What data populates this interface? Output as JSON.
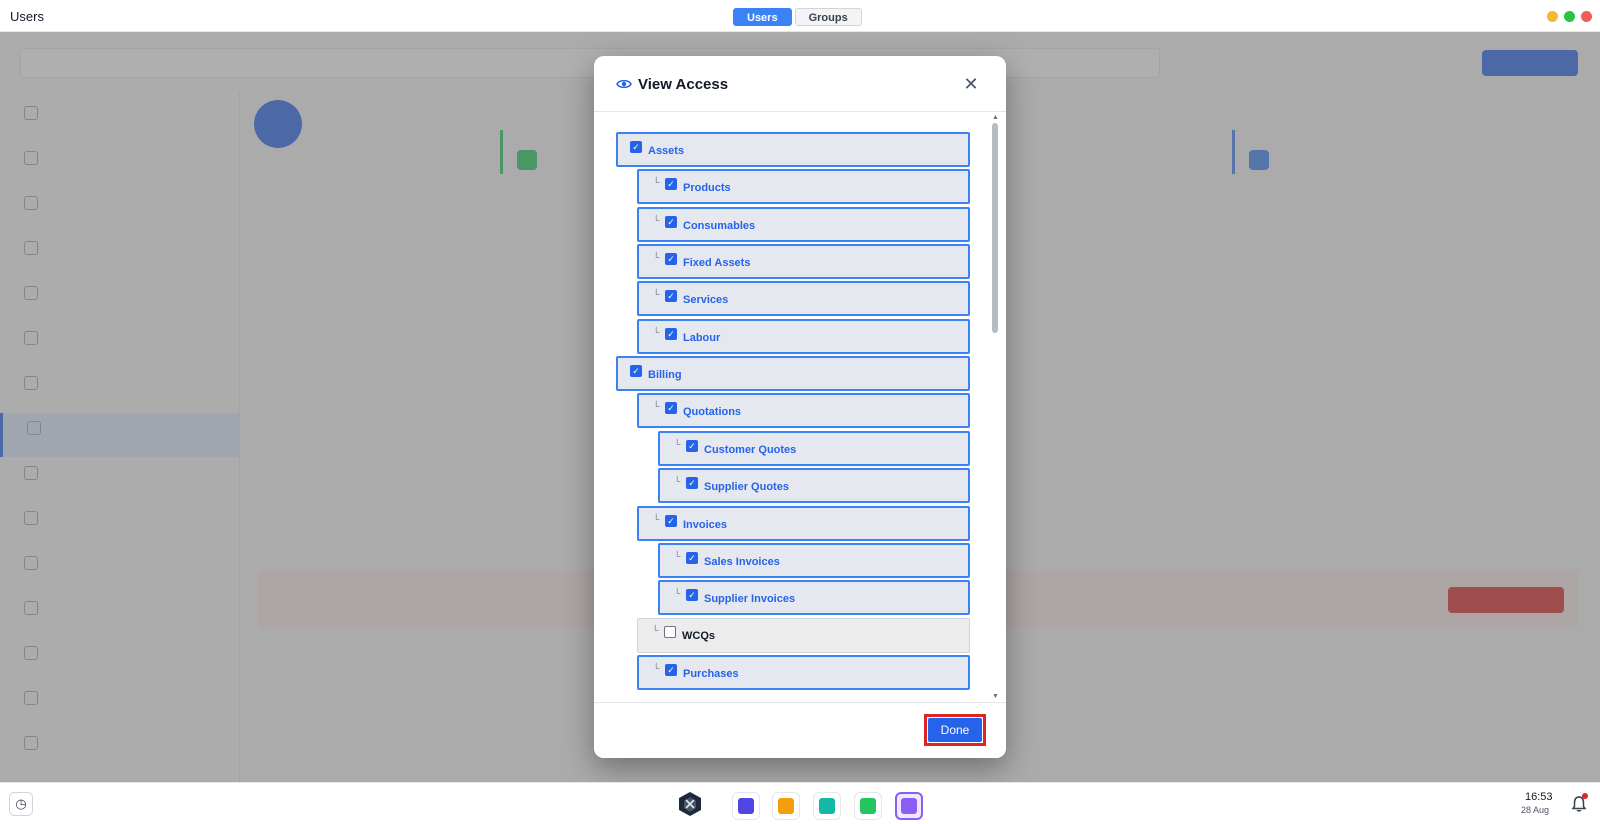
{
  "window": {
    "title": "Users",
    "tabs": [
      {
        "label": "Users",
        "active": true
      },
      {
        "label": "Groups",
        "active": false
      }
    ],
    "controls": {
      "minimize_color": "#f5b82e",
      "maximize_color": "#29c244",
      "close_color": "#f25b57"
    }
  },
  "modal": {
    "title": "View Access",
    "title_icon": "eye-icon",
    "close_icon": "close-icon",
    "done_label": "Done",
    "permissions": [
      {
        "label": "Assets",
        "level": 0,
        "checked": true
      },
      {
        "label": "Products",
        "level": 1,
        "checked": true
      },
      {
        "label": "Consumables",
        "level": 1,
        "checked": true
      },
      {
        "label": "Fixed Assets",
        "level": 1,
        "checked": true
      },
      {
        "label": "Services",
        "level": 1,
        "checked": true
      },
      {
        "label": "Labour",
        "level": 1,
        "checked": true
      },
      {
        "label": "Billing",
        "level": 0,
        "checked": true
      },
      {
        "label": "Quotations",
        "level": 1,
        "checked": true
      },
      {
        "label": "Customer Quotes",
        "level": 2,
        "checked": true
      },
      {
        "label": "Supplier Quotes",
        "level": 2,
        "checked": true
      },
      {
        "label": "Invoices",
        "level": 1,
        "checked": true
      },
      {
        "label": "Sales Invoices",
        "level": 2,
        "checked": true
      },
      {
        "label": "Supplier Invoices",
        "level": 2,
        "checked": true
      },
      {
        "label": "WCQs",
        "level": 1,
        "checked": false
      },
      {
        "label": "Purchases",
        "level": 1,
        "checked": true
      }
    ]
  },
  "taskbar": {
    "time": "16:53",
    "date": "28 Aug",
    "history_icon": "history-icon",
    "bell_icon": "bell-icon",
    "apps": [
      {
        "name": "contacts-app-icon",
        "color": "#4f46e5"
      },
      {
        "name": "network-app-icon",
        "color": "#f59e0b"
      },
      {
        "name": "billing-app-icon",
        "color": "#14b8a6"
      },
      {
        "name": "clipboard-app-icon",
        "color": "#22c55e"
      },
      {
        "name": "shield-app-icon",
        "color": "#8b5cf6",
        "active": true
      }
    ],
    "accent": "#8b5cf6"
  }
}
